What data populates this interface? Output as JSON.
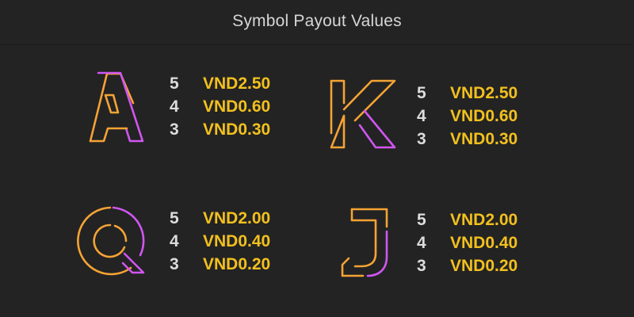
{
  "header": {
    "title": "Symbol Payout Values"
  },
  "colors": {
    "background": "#232323",
    "count_text": "#dcdcdc",
    "payout_text": "#f2c01e",
    "neon_orange": "#f5a334",
    "neon_purple": "#d056f0"
  },
  "symbols": [
    {
      "name": "A",
      "icon": "letter-a-neon-icon",
      "payouts": [
        {
          "count": "5",
          "value": "VND2.50"
        },
        {
          "count": "4",
          "value": "VND0.60"
        },
        {
          "count": "3",
          "value": "VND0.30"
        }
      ]
    },
    {
      "name": "K",
      "icon": "letter-k-neon-icon",
      "payouts": [
        {
          "count": "5",
          "value": "VND2.50"
        },
        {
          "count": "4",
          "value": "VND0.60"
        },
        {
          "count": "3",
          "value": "VND0.30"
        }
      ]
    },
    {
      "name": "Q",
      "icon": "letter-q-neon-icon",
      "payouts": [
        {
          "count": "5",
          "value": "VND2.00"
        },
        {
          "count": "4",
          "value": "VND0.40"
        },
        {
          "count": "3",
          "value": "VND0.20"
        }
      ]
    },
    {
      "name": "J",
      "icon": "letter-j-neon-icon",
      "payouts": [
        {
          "count": "5",
          "value": "VND2.00"
        },
        {
          "count": "4",
          "value": "VND0.40"
        },
        {
          "count": "3",
          "value": "VND0.20"
        }
      ]
    }
  ]
}
